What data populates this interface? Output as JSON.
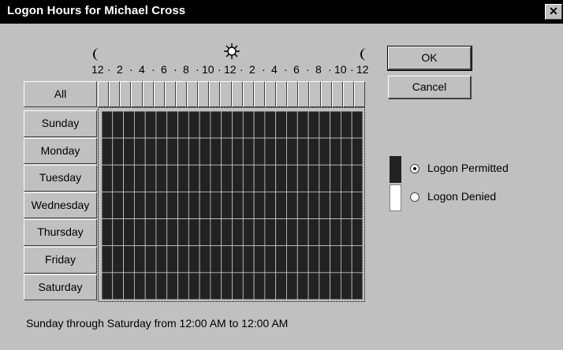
{
  "window": {
    "title": "Logon Hours for Michael Cross",
    "close_label": "✕"
  },
  "hours_scale": {
    "labels": [
      "12",
      "2",
      "4",
      "6",
      "8",
      "10",
      "12",
      "2",
      "4",
      "6",
      "8",
      "10",
      "12"
    ],
    "icons": [
      "moon-icon",
      "sun-icon",
      "moon-icon"
    ]
  },
  "grid": {
    "all_label": "All",
    "days": [
      "Sunday",
      "Monday",
      "Tuesday",
      "Wednesday",
      "Thursday",
      "Friday",
      "Saturday"
    ],
    "hours_per_day": 24,
    "permitted_fraction": 1.0
  },
  "buttons": {
    "ok": "OK",
    "cancel": "Cancel"
  },
  "legend": {
    "permitted_label": "Logon Permitted",
    "permitted_access_key": "P",
    "denied_label": "Logon Denied",
    "denied_access_key": "D",
    "selected": "permitted",
    "permitted_color": "#222222",
    "denied_color": "#ffffff"
  },
  "status_text": "Sunday through Saturday from 12:00 AM to 12:00 AM"
}
